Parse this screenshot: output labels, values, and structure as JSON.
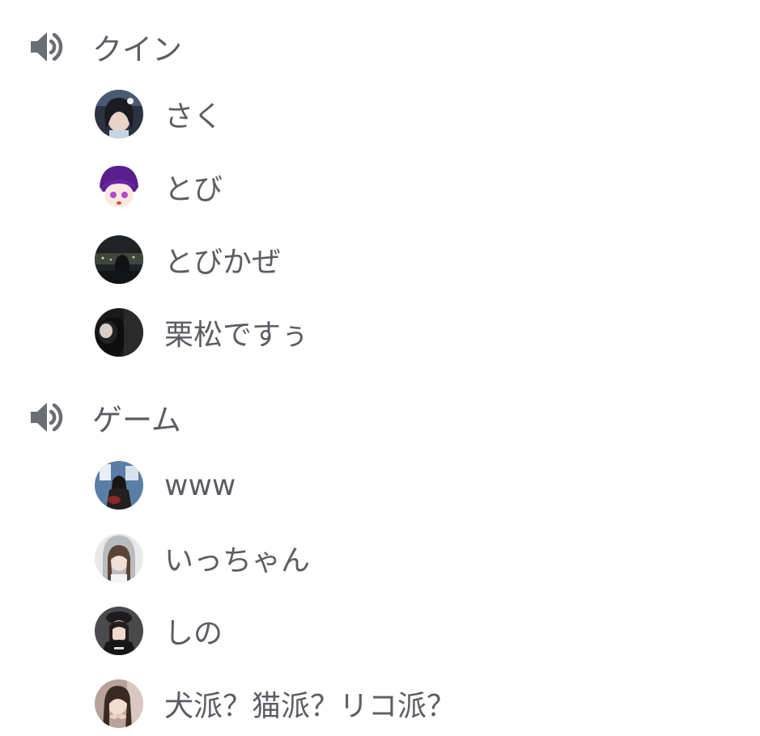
{
  "channels": [
    {
      "name": "クイン",
      "icon": "speaker-icon",
      "members": [
        {
          "name": "さく",
          "avatar": "avatar-photo"
        },
        {
          "name": "とび",
          "avatar": "avatar-illustration"
        },
        {
          "name": "とびかぜ",
          "avatar": "avatar-photo"
        },
        {
          "name": "栗松ですぅ",
          "avatar": "avatar-photo"
        }
      ]
    },
    {
      "name": "ゲーム",
      "icon": "speaker-icon",
      "members": [
        {
          "name": "www",
          "avatar": "avatar-photo"
        },
        {
          "name": "いっちゃん",
          "avatar": "avatar-photo"
        },
        {
          "name": "しの",
          "avatar": "avatar-photo"
        },
        {
          "name": "犬派？猫派？リコ派？",
          "avatar": "avatar-photo"
        }
      ]
    }
  ],
  "colors": {
    "text": "#5c5d63",
    "icon": "#6b6d74",
    "background": "#ffffff"
  }
}
